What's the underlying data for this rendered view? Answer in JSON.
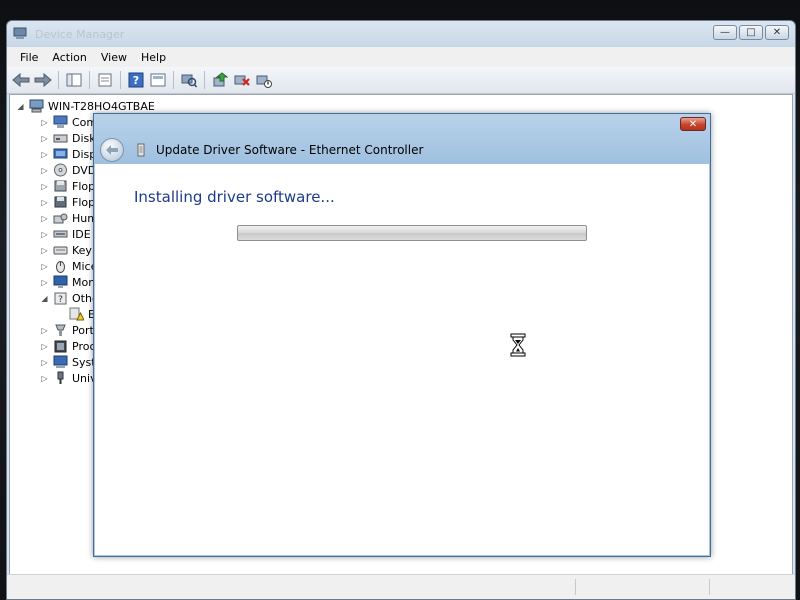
{
  "window": {
    "title": "Device Manager",
    "menu": [
      "File",
      "Action",
      "View",
      "Help"
    ],
    "toolbar_icons": [
      "back-arrow-icon",
      "forward-arrow-icon",
      "console-tree-icon",
      "properties-icon",
      "help-icon",
      "show-view-icon",
      "scan-hardware-icon",
      "update-driver-icon",
      "uninstall-icon",
      "disable-icon"
    ],
    "caption_buttons": {
      "minimize": "—",
      "maximize": "□",
      "close": "✕"
    }
  },
  "tree": {
    "computer": "WIN-T28HO4GTBAE",
    "items": [
      {
        "label": "Com",
        "icon": "computer-icon",
        "expander": "▷"
      },
      {
        "label": "Disk",
        "icon": "disk-drive-icon",
        "expander": "▷"
      },
      {
        "label": "Disp",
        "icon": "display-adapter-icon",
        "expander": "▷"
      },
      {
        "label": "DVD",
        "icon": "dvd-drive-icon",
        "expander": "▷"
      },
      {
        "label": "Flop",
        "icon": "floppy-controller-icon",
        "expander": "▷"
      },
      {
        "label": "Flop",
        "icon": "floppy-drive-icon",
        "expander": "▷"
      },
      {
        "label": "Hum",
        "icon": "hid-icon",
        "expander": "▷"
      },
      {
        "label": "IDE",
        "icon": "ide-controller-icon",
        "expander": "▷"
      },
      {
        "label": "Keyb",
        "icon": "keyboard-icon",
        "expander": "▷"
      },
      {
        "label": "Mice",
        "icon": "mouse-icon",
        "expander": "▷"
      },
      {
        "label": "Mon",
        "icon": "monitor-icon",
        "expander": "▷"
      },
      {
        "label": "Othe",
        "icon": "other-devices-icon",
        "expander": "◢"
      },
      {
        "label": "E",
        "icon": "warning-device-icon",
        "expander": ""
      },
      {
        "label": "Port",
        "icon": "port-icon",
        "expander": "▷"
      },
      {
        "label": "Proc",
        "icon": "processor-icon",
        "expander": "▷"
      },
      {
        "label": "Syst",
        "icon": "system-devices-icon",
        "expander": "▷"
      },
      {
        "label": "Univ",
        "icon": "usb-controller-icon",
        "expander": "▷"
      }
    ]
  },
  "dialog": {
    "title": "Update Driver Software - Ethernet Controller",
    "heading": "Installing driver software...",
    "progress": 0,
    "close_label": "✕"
  },
  "colors": {
    "dialog_heading": "#1e3b8a",
    "dialog_frame": "#a9c6e4",
    "close_button": "#c8442c"
  }
}
